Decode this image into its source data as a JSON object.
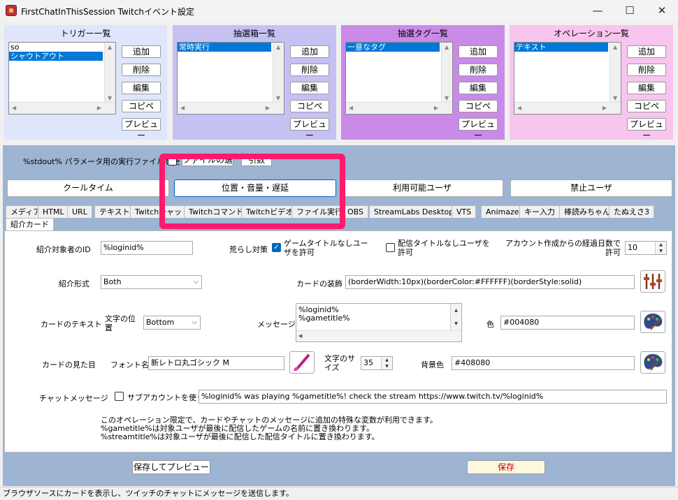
{
  "window": {
    "title": "FirstChatInThisSession Twitchイベント設定",
    "minimize": "—",
    "maximize": "☐",
    "close": "✕"
  },
  "panels": [
    {
      "title": "トリガー一覧",
      "items": [
        "so",
        "シャウトアウト"
      ],
      "selected": 1,
      "color": "#dfe6fb"
    },
    {
      "title": "抽選箱一覧",
      "items": [
        "常時実行"
      ],
      "selected": 0,
      "color": "#c5c1f3"
    },
    {
      "title": "抽選タグ一覧",
      "items": [
        "一意なタグ"
      ],
      "selected": 0,
      "color": "#c98ae8"
    },
    {
      "title": "オペレーション一覧",
      "items": [
        "テキスト"
      ],
      "selected": 0,
      "color": "#f7c5ee"
    }
  ],
  "panel_buttons": {
    "add": "追加",
    "delete": "削除",
    "edit": "編集",
    "copy": "コピペ",
    "preview": "プレビュー"
  },
  "stdout_row": {
    "label": "%stdout% パラメータ用の実行ファイルを使",
    "file_button": "ファイルの選",
    "args_button": "引数"
  },
  "big_buttons": {
    "cooltime": "クールタイム",
    "position": "位置・音量・遅延",
    "available_users": "利用可能ユーザ",
    "banned_users": "禁止ユーザ"
  },
  "tabs": [
    "メディア",
    "HTML",
    "URL",
    "テキスト",
    "Twitchチャット",
    "Twitchコマンド",
    "Twitchビデオ",
    "ファイル実行",
    "OBS",
    "StreamLabs Desktop",
    "VTS",
    "Animaze",
    "キー入力",
    "棒読みちゃん",
    "たぬえさ3"
  ],
  "active_tab": "紹介カード",
  "form": {
    "target_id_label": "紹介対象者のID",
    "target_id_value": "%loginid%",
    "troll_label": "荒らし対策",
    "no_game_title": "ゲームタイトルなしユーザを許可",
    "no_stream_title": "配信タイトルなしユーザを許可",
    "account_age_label": "アカウント作成からの経過日数で許可",
    "account_age_value": "10",
    "format_label": "紹介形式",
    "format_value": "Both",
    "decoration_label": "カードの装飾",
    "decoration_value": "(borderWidth:10px)(borderColor:#FFFFFF)(borderStyle:solid)",
    "card_text_label": "カードのテキスト",
    "text_position_label": "文字の位置",
    "text_position_value": "Bottom",
    "message_label": "メッセージ",
    "message_lines": [
      "%loginid%",
      "%gametitle%"
    ],
    "color_label": "色",
    "color_value": "#004080",
    "card_look_label": "カードの見た目",
    "font_name_label": "フォント名",
    "font_name_value": "新レトロ丸ゴシック M",
    "font_size_label": "文字のサイズ",
    "font_size_value": "35",
    "bg_color_label": "背景色",
    "bg_color_value": "#408080",
    "chat_label": "チャットメッセージ",
    "sub_account_label": "サブアカウントを使う",
    "chat_value": "%loginid% was playing %gametitle%! check the stream  https://www.twitch.tv/%loginid%",
    "info_lines": [
      "このオペレーション限定で、カードやチャットのメッセージに追加の特殊な変数が利用できます。",
      "%gametitle%は対象ユーザが最後に配信したゲームの名前に置き換わります。",
      "%streamtitle%は対象ユーザが最後に配信した配信タイトルに置き換わります。"
    ]
  },
  "bottom_buttons": {
    "save_preview": "保存してプレビュー",
    "save": "保存"
  },
  "status": "ブラウザソースにカードを表示し、ツイッチのチャットにメッセージを送信します。"
}
